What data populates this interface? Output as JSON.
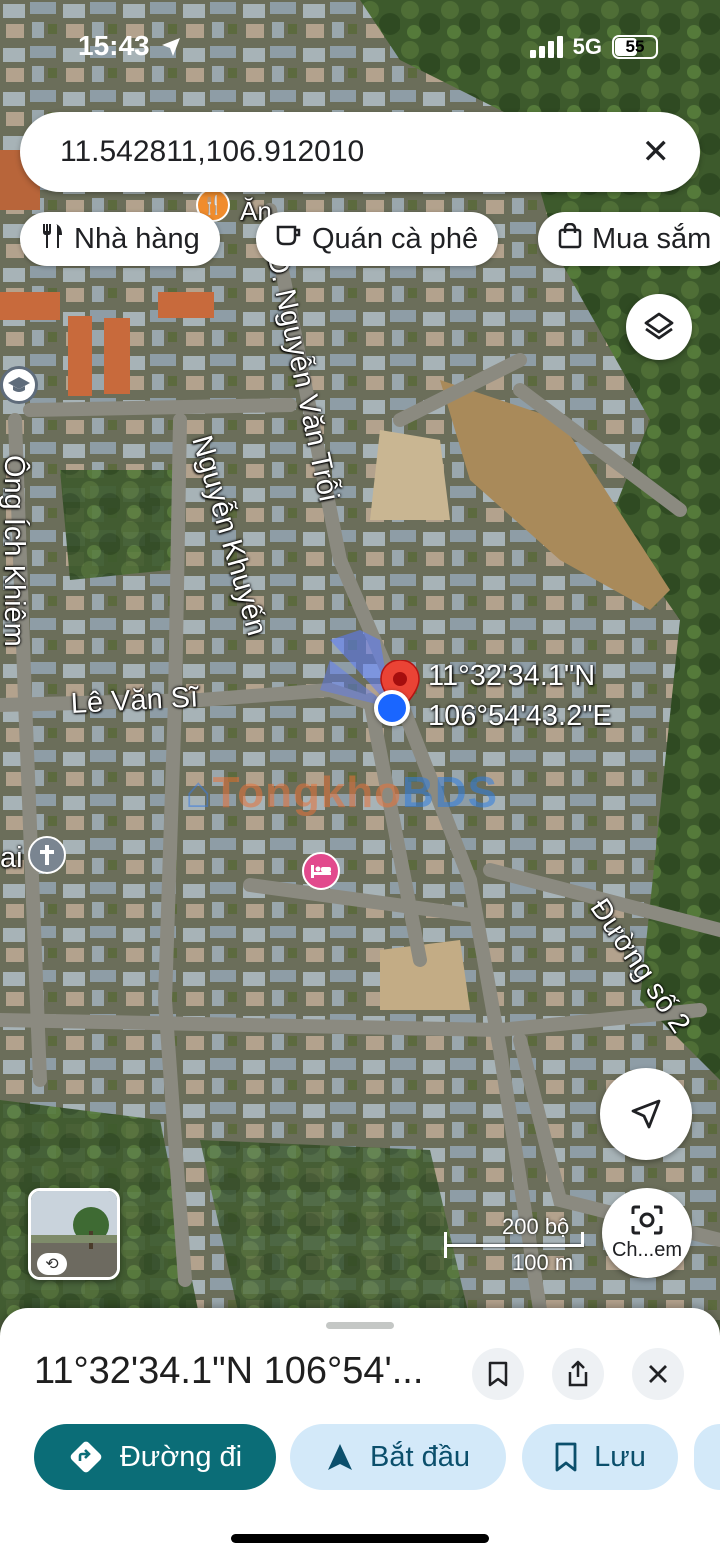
{
  "status_bar": {
    "time": "15:43",
    "network": "5G",
    "battery": "55"
  },
  "search": {
    "query": "11.542811,106.912010"
  },
  "chips": [
    {
      "label": "Nhà hàng",
      "icon": "fork-knife-icon"
    },
    {
      "label": "Quán cà phê",
      "icon": "coffee-cup-icon"
    },
    {
      "label": "Mua sắm",
      "icon": "shopping-bag-icon"
    }
  ],
  "map": {
    "roads": {
      "nguyen_van_troi": "Đ. Nguyễn Văn Trỗi",
      "nguyen_khuyen": "Nguyễn Khuyến",
      "ong_ich_khiem": "Ông Ích Khiêm",
      "le_van_si": "Lê Văn Sĩ",
      "duong_so_2": "Đường số 2",
      "partial_left": "ai",
      "partial_top": "Ăn"
    },
    "pin_coordinates": {
      "lat": "11°32'34.1\"N",
      "lng": "106°54'43.2\"E"
    },
    "watermark": {
      "part1": "Tongkho",
      "part2": "BDS"
    },
    "scale": {
      "imperial": "200 bộ",
      "metric": "100 m"
    },
    "camera_label": "Ch...em"
  },
  "sheet": {
    "title": "11°32'34.1\"N 106°54'...",
    "actions": [
      {
        "label": "Đường đi",
        "icon": "directions-icon"
      },
      {
        "label": "Bắt đầu",
        "icon": "navigation-arrow-icon"
      },
      {
        "label": "Lưu",
        "icon": "bookmark-icon"
      }
    ]
  },
  "colors": {
    "accent": "#0b6d77",
    "pill_bg": "#d3e9f9",
    "pin_red": "#ea4335",
    "location_blue": "#1a66ff"
  }
}
